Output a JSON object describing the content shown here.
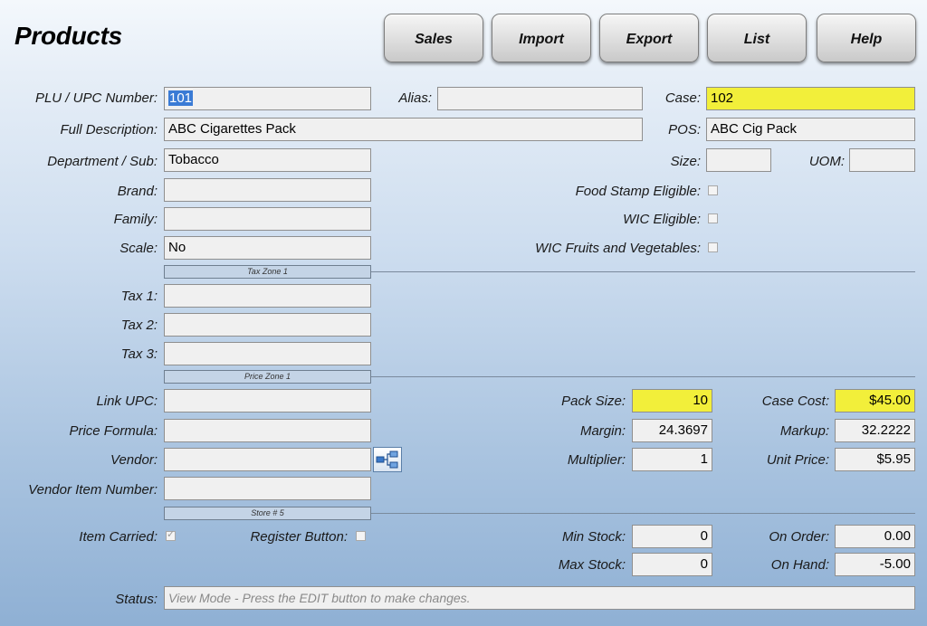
{
  "page_title": "Products",
  "toolbar": {
    "sales": "Sales",
    "import": "Import",
    "export": "Export",
    "list": "List",
    "help": "Help"
  },
  "labels": {
    "plu_upc": "PLU / UPC Number:",
    "alias": "Alias:",
    "case": "Case:",
    "full_description": "Full Description:",
    "pos": "POS:",
    "department_sub": "Department / Sub:",
    "size": "Size:",
    "uom": "UOM:",
    "brand": "Brand:",
    "food_stamp": "Food Stamp Eligible:",
    "family": "Family:",
    "wic": "WIC Eligible:",
    "scale": "Scale:",
    "wic_fruits": "WIC Fruits and Vegetables:",
    "tax1": "Tax 1:",
    "tax2": "Tax 2:",
    "tax3": "Tax 3:",
    "link_upc": "Link UPC:",
    "pack_size": "Pack Size:",
    "case_cost": "Case Cost:",
    "price_formula": "Price Formula:",
    "margin": "Margin:",
    "markup": "Markup:",
    "vendor": "Vendor:",
    "multiplier": "Multiplier:",
    "unit_price": "Unit Price:",
    "vendor_item_number": "Vendor Item Number:",
    "item_carried": "Item Carried:",
    "register_button": "Register Button:",
    "min_stock": "Min Stock:",
    "on_order": "On Order:",
    "max_stock": "Max Stock:",
    "on_hand": "On Hand:",
    "status": "Status:"
  },
  "values": {
    "plu_upc": "101",
    "alias": "",
    "case": "102",
    "full_description": "ABC Cigarettes Pack",
    "pos": "ABC Cig Pack",
    "department_sub": "Tobacco",
    "size": "",
    "uom": "",
    "brand": "",
    "family": "",
    "scale": "No",
    "tax1": "",
    "tax2": "",
    "tax3": "",
    "link_upc": "",
    "pack_size": "10",
    "case_cost": "$45.00",
    "price_formula": "",
    "margin": "24.3697",
    "markup": "32.2222",
    "vendor": "",
    "multiplier": "1",
    "unit_price": "$5.95",
    "vendor_item_number": "",
    "min_stock": "0",
    "on_order": "0.00",
    "max_stock": "0",
    "on_hand": "-5.00",
    "status": "View Mode - Press the EDIT button to make changes."
  },
  "checkboxes": {
    "food_stamp": false,
    "wic": false,
    "wic_fruits": false,
    "item_carried": true,
    "register_button": false
  },
  "zones": {
    "tax": "Tax Zone 1",
    "price": "Price Zone 1",
    "store": "Store # 5"
  },
  "icons": {
    "vendor_lookup": "vendor-lookup-icon"
  },
  "colors": {
    "highlight_field": "#f2ef3a",
    "selection": "#3a7bd5"
  }
}
